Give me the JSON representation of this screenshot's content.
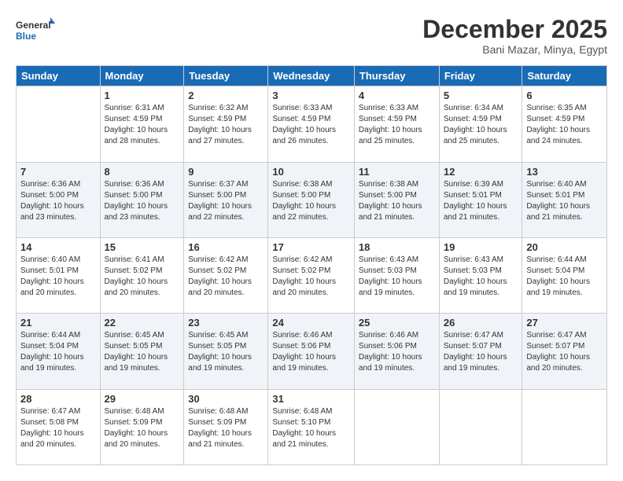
{
  "header": {
    "logo_line1": "General",
    "logo_line2": "Blue",
    "month": "December 2025",
    "location": "Bani Mazar, Minya, Egypt"
  },
  "weekdays": [
    "Sunday",
    "Monday",
    "Tuesday",
    "Wednesday",
    "Thursday",
    "Friday",
    "Saturday"
  ],
  "weeks": [
    [
      {
        "day": "",
        "info": ""
      },
      {
        "day": "1",
        "info": "Sunrise: 6:31 AM\nSunset: 4:59 PM\nDaylight: 10 hours\nand 28 minutes."
      },
      {
        "day": "2",
        "info": "Sunrise: 6:32 AM\nSunset: 4:59 PM\nDaylight: 10 hours\nand 27 minutes."
      },
      {
        "day": "3",
        "info": "Sunrise: 6:33 AM\nSunset: 4:59 PM\nDaylight: 10 hours\nand 26 minutes."
      },
      {
        "day": "4",
        "info": "Sunrise: 6:33 AM\nSunset: 4:59 PM\nDaylight: 10 hours\nand 25 minutes."
      },
      {
        "day": "5",
        "info": "Sunrise: 6:34 AM\nSunset: 4:59 PM\nDaylight: 10 hours\nand 25 minutes."
      },
      {
        "day": "6",
        "info": "Sunrise: 6:35 AM\nSunset: 4:59 PM\nDaylight: 10 hours\nand 24 minutes."
      }
    ],
    [
      {
        "day": "7",
        "info": "Sunrise: 6:36 AM\nSunset: 5:00 PM\nDaylight: 10 hours\nand 23 minutes."
      },
      {
        "day": "8",
        "info": "Sunrise: 6:36 AM\nSunset: 5:00 PM\nDaylight: 10 hours\nand 23 minutes."
      },
      {
        "day": "9",
        "info": "Sunrise: 6:37 AM\nSunset: 5:00 PM\nDaylight: 10 hours\nand 22 minutes."
      },
      {
        "day": "10",
        "info": "Sunrise: 6:38 AM\nSunset: 5:00 PM\nDaylight: 10 hours\nand 22 minutes."
      },
      {
        "day": "11",
        "info": "Sunrise: 6:38 AM\nSunset: 5:00 PM\nDaylight: 10 hours\nand 21 minutes."
      },
      {
        "day": "12",
        "info": "Sunrise: 6:39 AM\nSunset: 5:01 PM\nDaylight: 10 hours\nand 21 minutes."
      },
      {
        "day": "13",
        "info": "Sunrise: 6:40 AM\nSunset: 5:01 PM\nDaylight: 10 hours\nand 21 minutes."
      }
    ],
    [
      {
        "day": "14",
        "info": "Sunrise: 6:40 AM\nSunset: 5:01 PM\nDaylight: 10 hours\nand 20 minutes."
      },
      {
        "day": "15",
        "info": "Sunrise: 6:41 AM\nSunset: 5:02 PM\nDaylight: 10 hours\nand 20 minutes."
      },
      {
        "day": "16",
        "info": "Sunrise: 6:42 AM\nSunset: 5:02 PM\nDaylight: 10 hours\nand 20 minutes."
      },
      {
        "day": "17",
        "info": "Sunrise: 6:42 AM\nSunset: 5:02 PM\nDaylight: 10 hours\nand 20 minutes."
      },
      {
        "day": "18",
        "info": "Sunrise: 6:43 AM\nSunset: 5:03 PM\nDaylight: 10 hours\nand 19 minutes."
      },
      {
        "day": "19",
        "info": "Sunrise: 6:43 AM\nSunset: 5:03 PM\nDaylight: 10 hours\nand 19 minutes."
      },
      {
        "day": "20",
        "info": "Sunrise: 6:44 AM\nSunset: 5:04 PM\nDaylight: 10 hours\nand 19 minutes."
      }
    ],
    [
      {
        "day": "21",
        "info": "Sunrise: 6:44 AM\nSunset: 5:04 PM\nDaylight: 10 hours\nand 19 minutes."
      },
      {
        "day": "22",
        "info": "Sunrise: 6:45 AM\nSunset: 5:05 PM\nDaylight: 10 hours\nand 19 minutes."
      },
      {
        "day": "23",
        "info": "Sunrise: 6:45 AM\nSunset: 5:05 PM\nDaylight: 10 hours\nand 19 minutes."
      },
      {
        "day": "24",
        "info": "Sunrise: 6:46 AM\nSunset: 5:06 PM\nDaylight: 10 hours\nand 19 minutes."
      },
      {
        "day": "25",
        "info": "Sunrise: 6:46 AM\nSunset: 5:06 PM\nDaylight: 10 hours\nand 19 minutes."
      },
      {
        "day": "26",
        "info": "Sunrise: 6:47 AM\nSunset: 5:07 PM\nDaylight: 10 hours\nand 19 minutes."
      },
      {
        "day": "27",
        "info": "Sunrise: 6:47 AM\nSunset: 5:07 PM\nDaylight: 10 hours\nand 20 minutes."
      }
    ],
    [
      {
        "day": "28",
        "info": "Sunrise: 6:47 AM\nSunset: 5:08 PM\nDaylight: 10 hours\nand 20 minutes."
      },
      {
        "day": "29",
        "info": "Sunrise: 6:48 AM\nSunset: 5:09 PM\nDaylight: 10 hours\nand 20 minutes."
      },
      {
        "day": "30",
        "info": "Sunrise: 6:48 AM\nSunset: 5:09 PM\nDaylight: 10 hours\nand 21 minutes."
      },
      {
        "day": "31",
        "info": "Sunrise: 6:48 AM\nSunset: 5:10 PM\nDaylight: 10 hours\nand 21 minutes."
      },
      {
        "day": "",
        "info": ""
      },
      {
        "day": "",
        "info": ""
      },
      {
        "day": "",
        "info": ""
      }
    ]
  ]
}
